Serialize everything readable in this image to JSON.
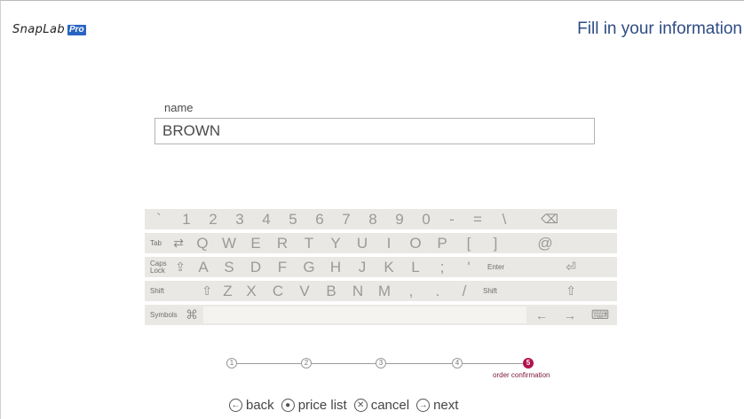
{
  "header": {
    "logo_text": "SnapLab",
    "logo_badge": "Pro",
    "title": "Fill in your information"
  },
  "form": {
    "name_label": "name",
    "name_value": "BROWN"
  },
  "keyboard": {
    "row1": [
      "`",
      "1",
      "2",
      "3",
      "4",
      "5",
      "6",
      "7",
      "8",
      "9",
      "0",
      "-",
      "=",
      "\\",
      "⌫"
    ],
    "row2": [
      "Q",
      "W",
      "E",
      "R",
      "T",
      "Y",
      "U",
      "I",
      "O",
      "P",
      "[",
      "]",
      "@"
    ],
    "row2_tab": "Tab",
    "row3": [
      "A",
      "S",
      "D",
      "F",
      "G",
      "H",
      "J",
      "K",
      "L",
      ";",
      "'"
    ],
    "row3_caps_1": "Caps",
    "row3_caps_2": "Lock",
    "row3_enter": "Enter",
    "row4": [
      "Z",
      "X",
      "C",
      "V",
      "B",
      "N",
      "M",
      ",",
      ".",
      "/"
    ],
    "row4_shift_left": "Shift",
    "row4_shift_right": "Shift",
    "row5_symbols": "Symbols"
  },
  "progress": {
    "steps": [
      "1",
      "2",
      "3",
      "4",
      "5"
    ],
    "active_step": 5,
    "active_label": "order confirmation"
  },
  "nav": {
    "back": "back",
    "price_list": "price list",
    "cancel": "cancel",
    "next": "next"
  }
}
